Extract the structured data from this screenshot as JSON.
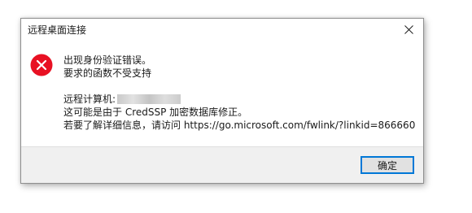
{
  "dialog": {
    "title": "远程桌面连接",
    "close_icon": "close-icon",
    "error_icon": "error-icon",
    "error_icon_color": "#e81123",
    "messages": {
      "line1": "出现身份验证错误。",
      "line2": "要求的函数不受支持",
      "remote_computer_label": "远程计算机:",
      "line4": "这可能是由于 CredSSP 加密数据库修正。",
      "line5": "若要了解详细信息，请访问 https://go.microsoft.com/fwlink/?linkid=866660"
    },
    "ok_button": "确定",
    "accent_color": "#0078d7"
  }
}
